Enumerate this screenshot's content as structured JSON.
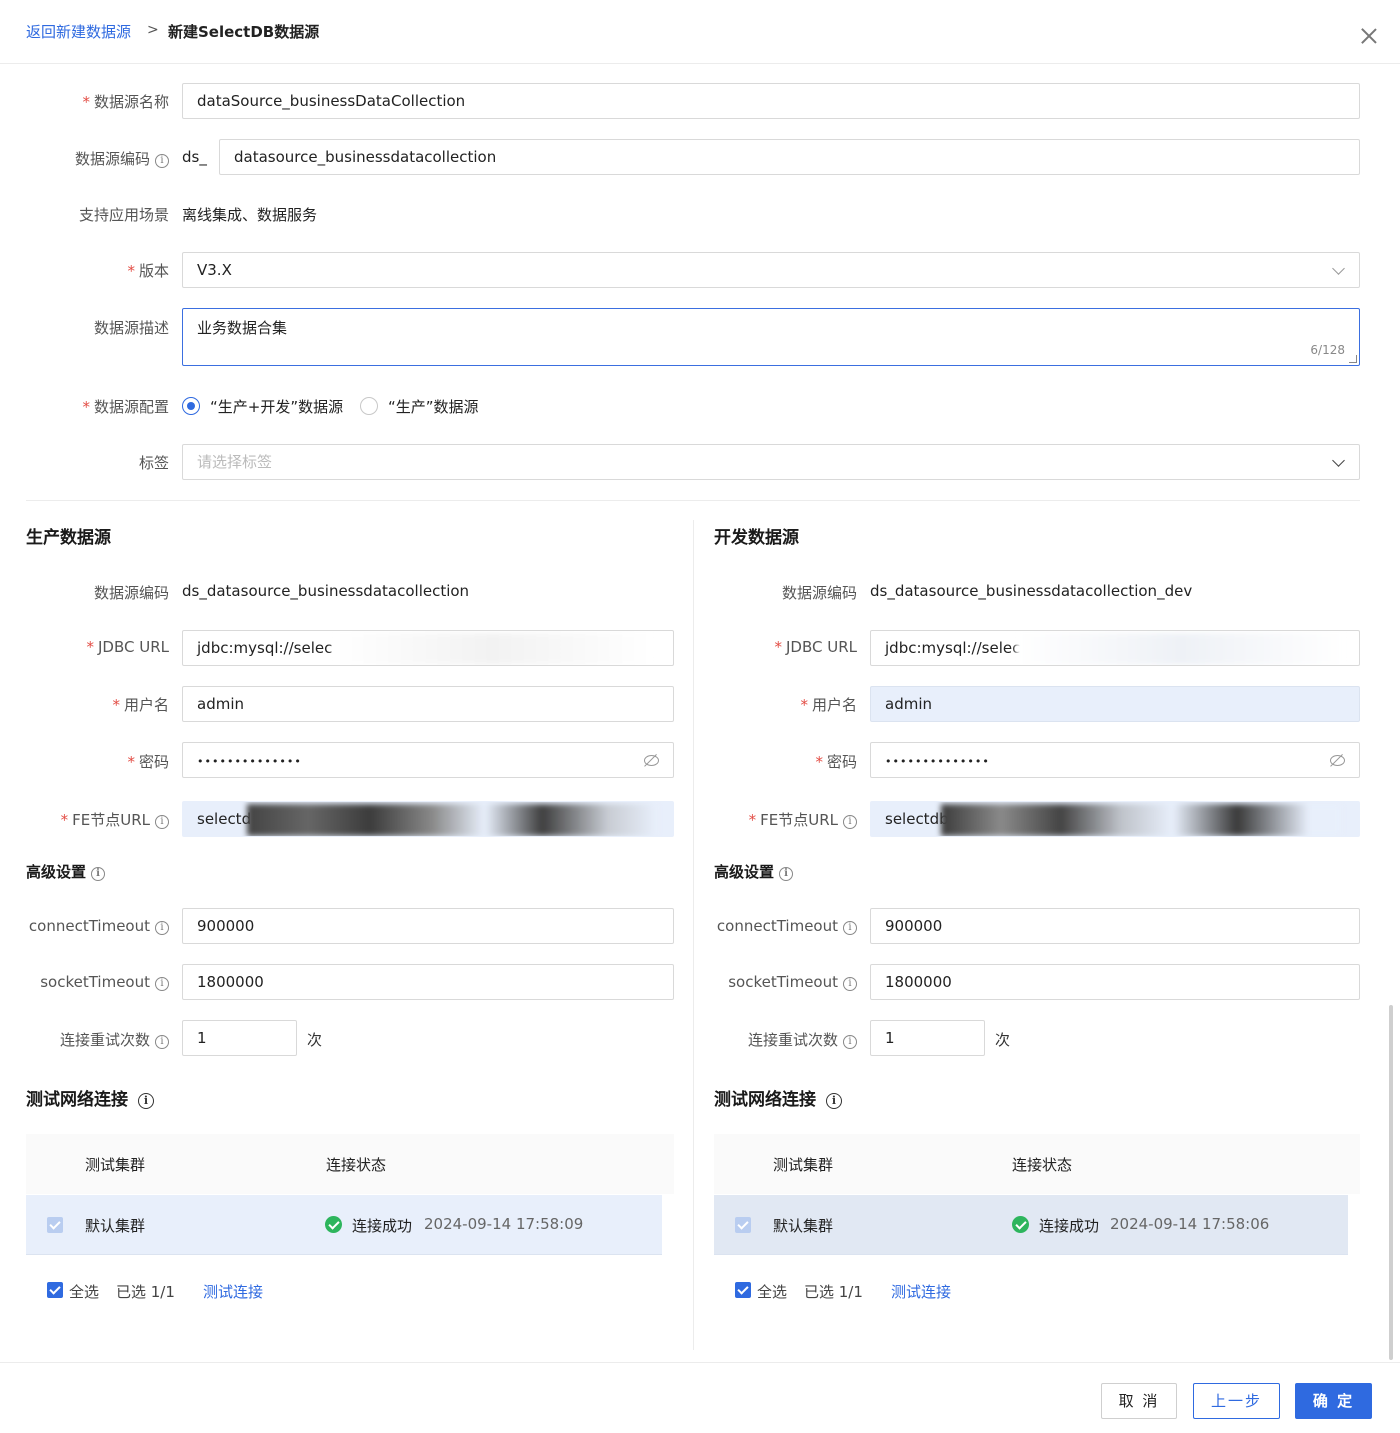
{
  "header": {
    "back_link": "返回新建数据源",
    "separator": ">",
    "current": "新建SelectDB数据源"
  },
  "form": {
    "name": {
      "label": "数据源名称",
      "value": "dataSource_businessDataCollection"
    },
    "code": {
      "label": "数据源编码",
      "prefix": "ds_",
      "value": "datasource_businessdatacollection"
    },
    "scenario": {
      "label": "支持应用场景",
      "value": "离线集成、数据服务"
    },
    "version": {
      "label": "版本",
      "value": "V3.X"
    },
    "description": {
      "label": "数据源描述",
      "value": "业务数据合集",
      "counter": "6/128"
    },
    "config": {
      "label": "数据源配置",
      "options": [
        "“生产+开发”数据源",
        "“生产”数据源"
      ],
      "selected": 0
    },
    "tags": {
      "label": "标签",
      "placeholder": "请选择标签"
    }
  },
  "production": {
    "title": "生产数据源",
    "code_label": "数据源编码",
    "code_value": "ds_datasource_businessdatacollection",
    "jdbc_label": "JDBC URL",
    "jdbc_value": "jdbc:mysql://selec",
    "username_label": "用户名",
    "username_value": "admin",
    "password_label": "密码",
    "password_value": "••••••••••••••",
    "fe_label": "FE节点URL",
    "fe_value": "selectd",
    "advanced_title": "高级设置",
    "connect_label": "connectTimeout",
    "connect_value": "900000",
    "socket_label": "socketTimeout",
    "socket_value": "1800000",
    "retry_label": "连接重试次数",
    "retry_value": "1",
    "retry_unit": "次",
    "test_title": "测试网络连接",
    "table": {
      "col_cluster": "测试集群",
      "col_status": "连接状态",
      "row_cluster": "默认集群",
      "row_status": "连接成功",
      "row_time": "2024-09-14 17:58:09"
    },
    "select_all": "全选",
    "selected_count": "已选 1/1",
    "test_link": "测试连接"
  },
  "development": {
    "title": "开发数据源",
    "code_label": "数据源编码",
    "code_value": "ds_datasource_businessdatacollection_dev",
    "jdbc_label": "JDBC URL",
    "jdbc_value": "jdbc:mysql://selec",
    "username_label": "用户名",
    "username_value": "admin",
    "password_label": "密码",
    "password_value": "••••••••••••••",
    "fe_label": "FE节点URL",
    "fe_value": "selectdb",
    "advanced_title": "高级设置",
    "connect_label": "connectTimeout",
    "connect_value": "900000",
    "socket_label": "socketTimeout",
    "socket_value": "1800000",
    "retry_label": "连接重试次数",
    "retry_value": "1",
    "retry_unit": "次",
    "test_title": "测试网络连接",
    "table": {
      "col_cluster": "测试集群",
      "col_status": "连接状态",
      "row_cluster": "默认集群",
      "row_status": "连接成功",
      "row_time": "2024-09-14 17:58:06"
    },
    "select_all": "全选",
    "selected_count": "已选 1/1",
    "test_link": "测试连接"
  },
  "footer": {
    "cancel": "取 消",
    "prev": "上一步",
    "confirm": "确 定"
  },
  "colors": {
    "accent": "#2f6ae0",
    "required": "#e34d45",
    "success": "#2db55d",
    "highlight": "#e8effb"
  },
  "icons": [
    "close-icon",
    "info-icon",
    "chevron-down-icon",
    "eye-off-icon",
    "check-circle-icon",
    "checkbox-checked-icon"
  ]
}
